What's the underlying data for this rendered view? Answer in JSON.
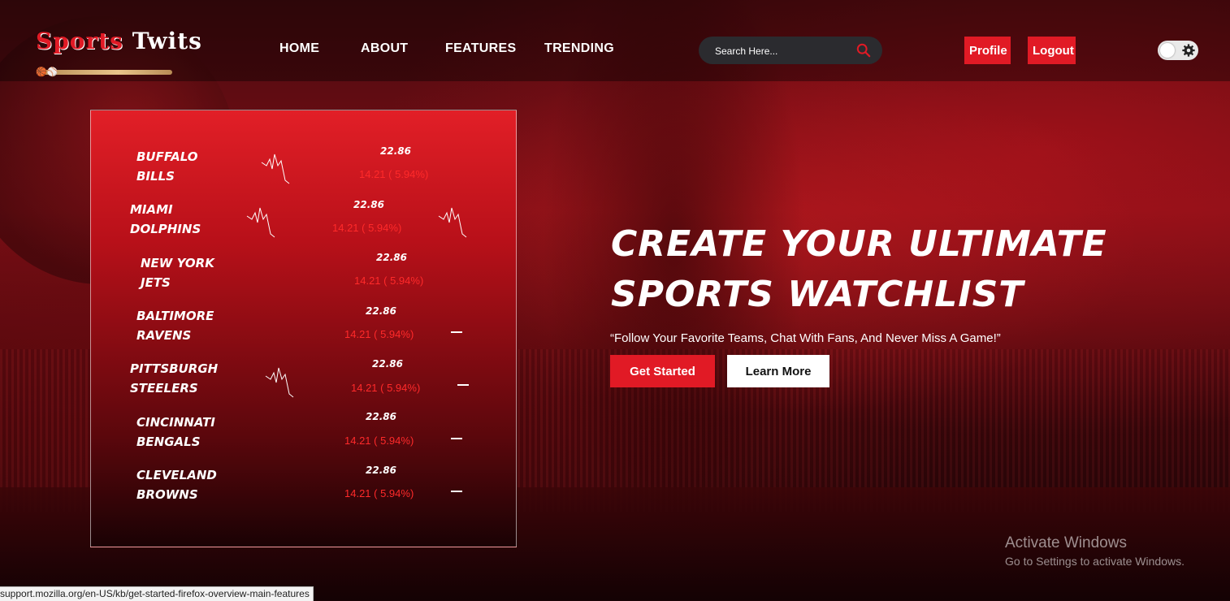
{
  "logo": {
    "part1": "Sports",
    "part2": "Twits"
  },
  "nav": {
    "items": [
      "HOME",
      "ABOUT",
      "FEATURES",
      "TRENDING"
    ],
    "search_placeholder": "Search Here...",
    "profile_label": "Profile",
    "logout_label": "Logout"
  },
  "watchlist": [
    {
      "name1": "BUFFALO",
      "name2": "BILLS",
      "price": "22.86",
      "change": "14.21 ( 5.94%)"
    },
    {
      "name1": "MIAMI",
      "name2": "DOLPHINS",
      "price": "22.86",
      "change": "14.21 ( 5.94%)"
    },
    {
      "name1": "NEW YORK",
      "name2": "JETS",
      "price": "22.86",
      "change": "14.21 ( 5.94%)"
    },
    {
      "name1": "BALTIMORE",
      "name2": "RAVENS",
      "price": "22.86",
      "change": "14.21 ( 5.94%)"
    },
    {
      "name1": "PITTSBURGH",
      "name2": "STEELERS",
      "price": "22.86",
      "change": "14.21 ( 5.94%)"
    },
    {
      "name1": "CINCINNATI",
      "name2": "BENGALS",
      "price": "22.86",
      "change": "14.21 ( 5.94%)"
    },
    {
      "name1": "CLEVELAND",
      "name2": "BROWNS",
      "price": "22.86",
      "change": "14.21 ( 5.94%)"
    }
  ],
  "hero": {
    "title_line1": "CREATE YOUR ULTIMATE",
    "title_line2": "SPORTS WATCHLIST",
    "subtitle": "“Follow Your Favorite Teams, Chat With Fans, And Never Miss A Game!”",
    "get_started": "Get Started",
    "learn_more": "Learn More"
  },
  "watermark": {
    "line1": "Activate Windows",
    "line2": "Go to Settings to activate Windows."
  },
  "status_url": "support.mozilla.org/en-US/kb/get-started-firefox-overview-main-features",
  "colors": {
    "accent": "#e11a25",
    "change_red": "#ff2a2a"
  }
}
